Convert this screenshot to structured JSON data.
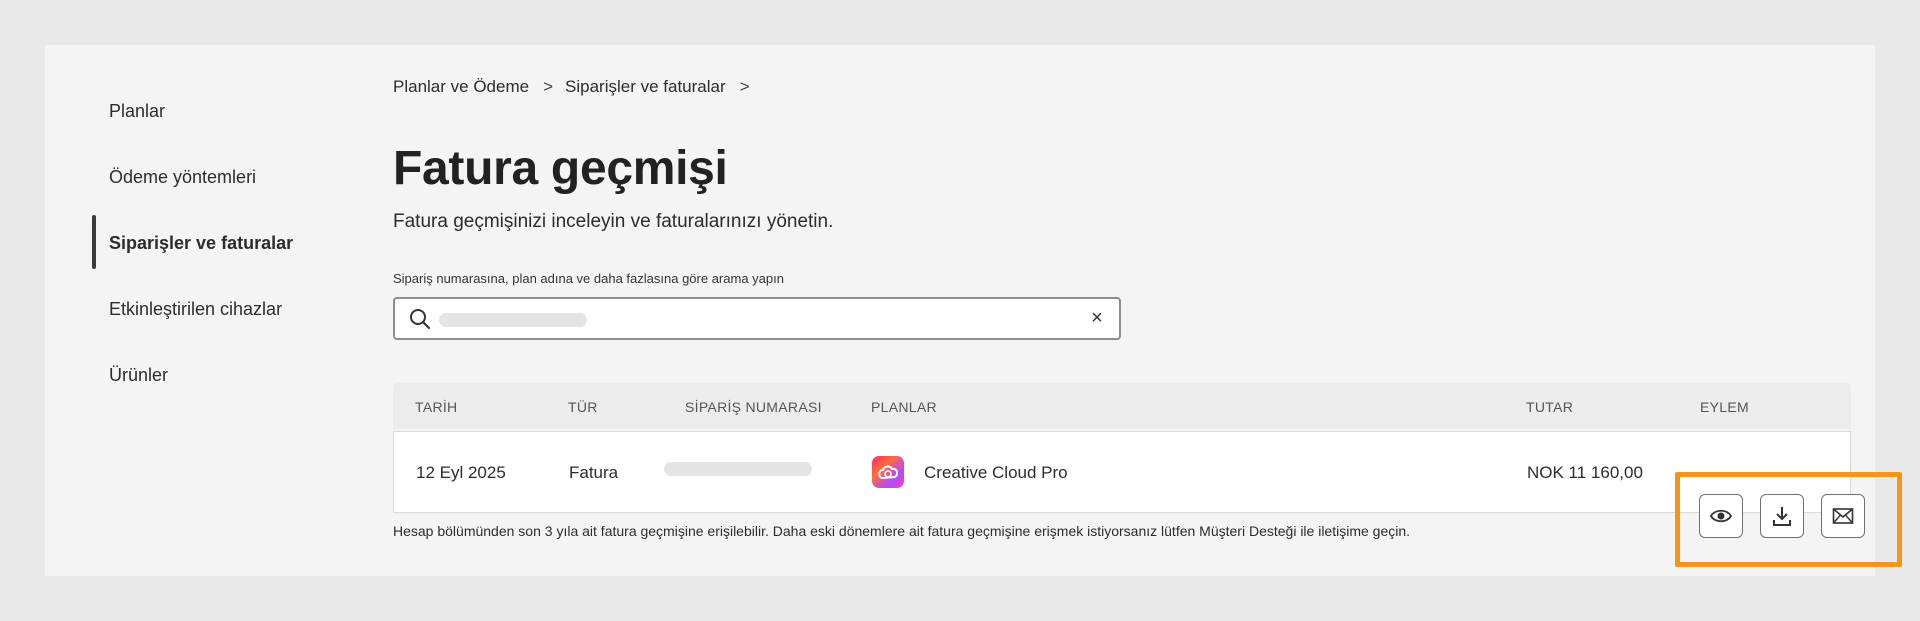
{
  "sidebar": {
    "items": [
      {
        "label": "Planlar",
        "active": false
      },
      {
        "label": "Ödeme yöntemleri",
        "active": false
      },
      {
        "label": "Siparişler ve faturalar",
        "active": true
      },
      {
        "label": "Etkinleştirilen cihazlar",
        "active": false
      },
      {
        "label": "Ürünler",
        "active": false
      }
    ]
  },
  "breadcrumb": {
    "items": [
      "Planlar ve Ödeme",
      "Siparişler ve faturalar"
    ],
    "separator": ">"
  },
  "page": {
    "title": "Fatura geçmişi",
    "subtitle": "Fatura geçmişinizi inceleyin ve faturalarınızı yönetin."
  },
  "search": {
    "label": "Sipariş numarasına, plan adına ve daha fazlasına göre arama yapın",
    "clear_glyph": "×"
  },
  "table": {
    "columns": [
      "TARİH",
      "TÜR",
      "SİPARİŞ NUMARASI",
      "PLANLAR",
      "TUTAR",
      "EYLEM"
    ],
    "rows": [
      {
        "date": "12 Eyl 2025",
        "type": "Fatura",
        "plan": "Creative Cloud Pro",
        "amount": "NOK 11 160,00"
      }
    ],
    "actions": [
      "eye-icon",
      "download-icon",
      "mail-icon"
    ]
  },
  "footnote": "Hesap bölümünden son 3 yıla ait fatura geçmişine erişilebilir. Daha eski dönemlere ait fatura geçmişine erişmek istiyorsanız lütfen Müşteri Desteği ile iletişime geçin.",
  "colors": {
    "highlight": "#f7941d",
    "background": "#e9e9e9",
    "panel": "#f4f4f4"
  }
}
